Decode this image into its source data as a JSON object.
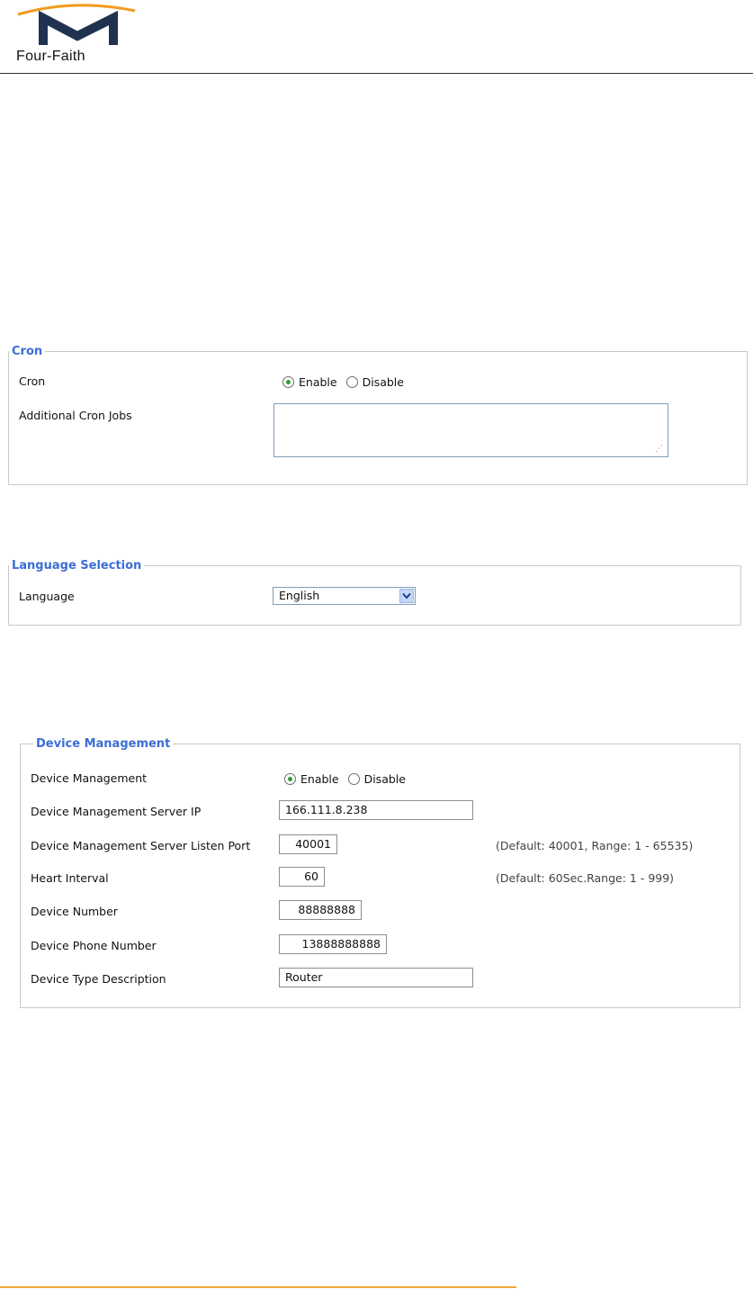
{
  "header": {
    "brand": "Four-Faith"
  },
  "cron": {
    "legend": "Cron",
    "cron_label": "Cron",
    "enable": "Enable",
    "disable": "Disable",
    "selected": "Enable",
    "jobs_label": "Additional Cron Jobs",
    "jobs_value": ""
  },
  "language": {
    "legend": "Language Selection",
    "label": "Language",
    "selected": "English"
  },
  "device": {
    "legend": "Device Management",
    "mgmt_label": "Device Management",
    "enable": "Enable",
    "disable": "Disable",
    "selected": "Enable",
    "server_ip_label": "Device Management Server IP",
    "server_ip": "166.111.8.238",
    "port_label": "Device Management Server Listen Port",
    "port": "40001",
    "port_hint": "(Default: 40001, Range: 1 - 65535)",
    "heart_label": "Heart Interval",
    "heart": "60",
    "heart_hint": "(Default: 60Sec.Range: 1 - 999)",
    "number_label": "Device Number",
    "number": "88888888",
    "phone_label": "Device Phone Number",
    "phone": "13888888888",
    "type_label": "Device Type Description",
    "type": "Router"
  },
  "colors": {
    "legend": "#3b6dd6",
    "footer_rule": "#f2a735",
    "logo_arc": "#f29b1d",
    "logo_mark": "#1f3350"
  }
}
